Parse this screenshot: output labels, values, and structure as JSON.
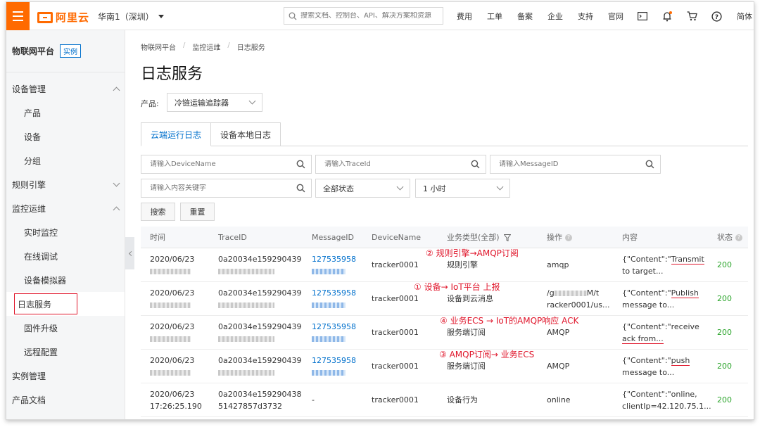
{
  "topbar": {
    "logo_text": "阿里云",
    "region": "华南1（深圳）",
    "search_placeholder": "搜索文档、控制台、API、解决方案和资源",
    "nav": [
      "费用",
      "工单",
      "备案",
      "企业",
      "支持",
      "官网"
    ],
    "lang": "简体",
    "accent": "#ff6a00"
  },
  "sidebar": {
    "title": "物联网平台",
    "badge": "实例",
    "sections": [
      {
        "label": "设备管理",
        "expanded": true,
        "items": [
          "产品",
          "设备",
          "分组"
        ]
      },
      {
        "label": "规则引擎",
        "expanded": false,
        "items": []
      },
      {
        "label": "监控运维",
        "expanded": true,
        "items": [
          "实时监控",
          "在线调试",
          "设备模拟器",
          "日志服务",
          "固件升级",
          "远程配置"
        ]
      },
      {
        "label": "实例管理",
        "expanded": false,
        "items": []
      },
      {
        "label": "产品文档",
        "expanded": false,
        "items": []
      }
    ],
    "active_item": "日志服务"
  },
  "breadcrumb": [
    "物联网平台",
    "监控运维",
    "日志服务"
  ],
  "page_title": "日志服务",
  "product": {
    "label": "产品:",
    "value": "冷链运输追踪器"
  },
  "tabs": [
    "云端运行日志",
    "设备本地日志"
  ],
  "filters": {
    "device_placeholder": "请输入DeviceName",
    "trace_placeholder": "请输入TraceId",
    "message_placeholder": "请输入MessageID",
    "keyword_placeholder": "请输入内容关键字",
    "status_value": "全部状态",
    "time_value": "1 小时",
    "search_label": "搜索",
    "reset_label": "重置"
  },
  "table": {
    "headers": [
      "时间",
      "TraceID",
      "MessageID",
      "DeviceName",
      "业务类型(全部)",
      "操作",
      "内容",
      "状态"
    ],
    "rows": [
      {
        "time": "2020/06/23",
        "trace": "0a20034e159290439",
        "msg": "127535958",
        "device": "tracker0001",
        "type": "规则引擎",
        "op": "amqp",
        "content1": "{\"Content\":\"",
        "content_hl": "Transmit",
        "content2": "to target...",
        "status": "200",
        "annotation": "② 规则引擎→AMQP订阅"
      },
      {
        "time": "2020/06/23",
        "trace": "0a20034e159290439",
        "msg": "127535958",
        "device": "tracker0001",
        "type": "设备到云消息",
        "op1": "/g",
        "op1b": "M/t",
        "op2": "racker0001/us...",
        "content1": "{\"Content\":\"",
        "content_hl": "Publish",
        "content2": "message to...",
        "status": "200",
        "annotation": "① 设备→ IoT平台 上报"
      },
      {
        "time": "2020/06/23",
        "trace": "0a20034e159290439",
        "msg": "127535958",
        "device": "tracker0001",
        "type": "服务端订阅",
        "op": "AMQP",
        "content1": "{\"Content\":\"receive",
        "content_hl": "ack from...",
        "content2": "",
        "status": "200",
        "annotation": "④ 业务ECS → IoT的AMQP响应 ACK"
      },
      {
        "time": "2020/06/23",
        "trace": "0a20034e159290439",
        "msg": "127535958",
        "device": "tracker0001",
        "type": "服务端订阅",
        "op": "AMQP",
        "content1": "{\"Content\":\"",
        "content_hl": "push",
        "content2": "message to...",
        "status": "200",
        "annotation": "③ AMQP订阅→ 业务ECS"
      },
      {
        "time": "2020/06/23",
        "time2": "17:26:25.190",
        "trace": "0a20034e159290438",
        "trace2": "51427857d3732",
        "msg": "-",
        "device": "tracker0001",
        "type": "设备行为",
        "op": "online",
        "content1": "{\"Content\":\"online,",
        "content2": "clientIp=42.120.75.1...",
        "status": "200"
      }
    ]
  }
}
